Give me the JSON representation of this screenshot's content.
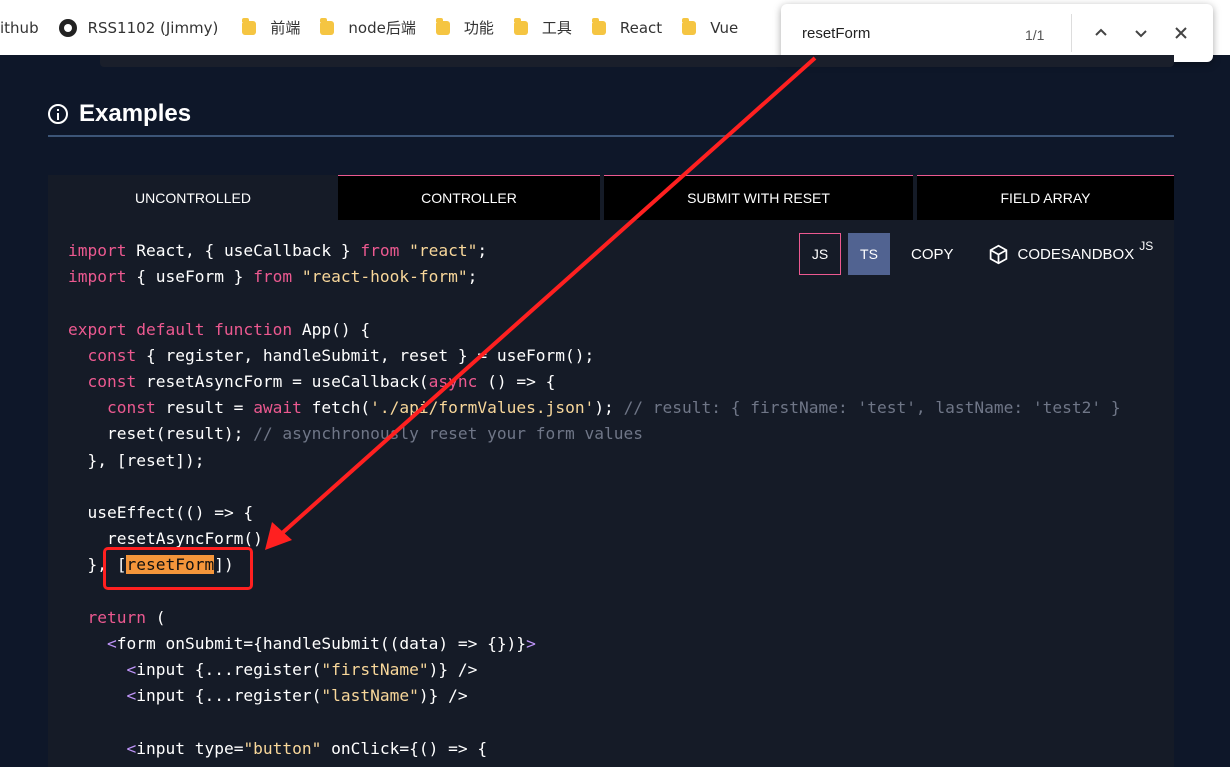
{
  "bookmarks": [
    {
      "label": "ithub",
      "icon": "none"
    },
    {
      "label": "RSS1102 (Jimmy)",
      "icon": "github-icon"
    },
    {
      "label": "前端",
      "icon": "folder-icon"
    },
    {
      "label": "node后端",
      "icon": "folder-icon"
    },
    {
      "label": "功能",
      "icon": "folder-icon"
    },
    {
      "label": "工具",
      "icon": "folder-icon"
    },
    {
      "label": "React",
      "icon": "folder-icon"
    },
    {
      "label": "Vue",
      "icon": "folder-icon"
    }
  ],
  "find": {
    "query": "resetForm",
    "count": "1/1"
  },
  "section": {
    "title": "Examples"
  },
  "tabs": [
    {
      "label": "UNCONTROLLED",
      "active": true
    },
    {
      "label": "CONTROLLER",
      "active": false
    },
    {
      "label": "SUBMIT WITH RESET",
      "active": false
    },
    {
      "label": "FIELD ARRAY",
      "active": false
    }
  ],
  "actions": {
    "js": "JS",
    "ts": "TS",
    "copy": "COPY",
    "sandbox": "CODESANDBOX",
    "sandbox_sup": "JS"
  },
  "code": {
    "import1_kw": "import",
    "import1_mid": " React, { useCallback } ",
    "import1_from": "from",
    "import1_str": "\"react\"",
    "import2_kw": "import",
    "import2_mid": " { useForm } ",
    "import2_from": "from",
    "import2_str": "\"react-hook-form\"",
    "export": "export default function",
    "app": " App() {",
    "const": "const",
    "register_line": " { register, handleSubmit, reset } = useForm();",
    "reset_async": " resetAsyncForm = useCallback(",
    "async": "async",
    "arrow_open": " () => {",
    "result": " result = ",
    "await": "await",
    "fetch": " fetch(",
    "fetch_str": "'./api/formValues.json'",
    "fetch_end": "); ",
    "comment1": "// result: { firstName: 'test', lastName: 'test2' }",
    "reset_call": "reset(result); ",
    "comment2": "// asynchronously reset your form values",
    "deps1": "}, [reset]);",
    "use_effect": "useEffect(() => {",
    "call_reset_async": "resetAsyncForm()",
    "deps2_open": "}, [",
    "deps2_hl": "resetForm",
    "deps2_close": "])",
    "return": "return",
    "return_paren": " (",
    "form_line": "form onSubmit={handleSubmit((data) => {})}",
    "input1_pre": "input {...register(",
    "input1_str": "\"firstName\"",
    "input1_post": ")} />",
    "input2_pre": "input {...register(",
    "input2_str": "\"lastName\"",
    "input2_post": ")} />",
    "input3_pre": "input type=",
    "input3_str": "\"button\"",
    "input3_post": " onClick={() => {"
  },
  "colors": {
    "accent": "#ec5990",
    "highlight": "#f4953a",
    "annotation": "#ff2020"
  }
}
